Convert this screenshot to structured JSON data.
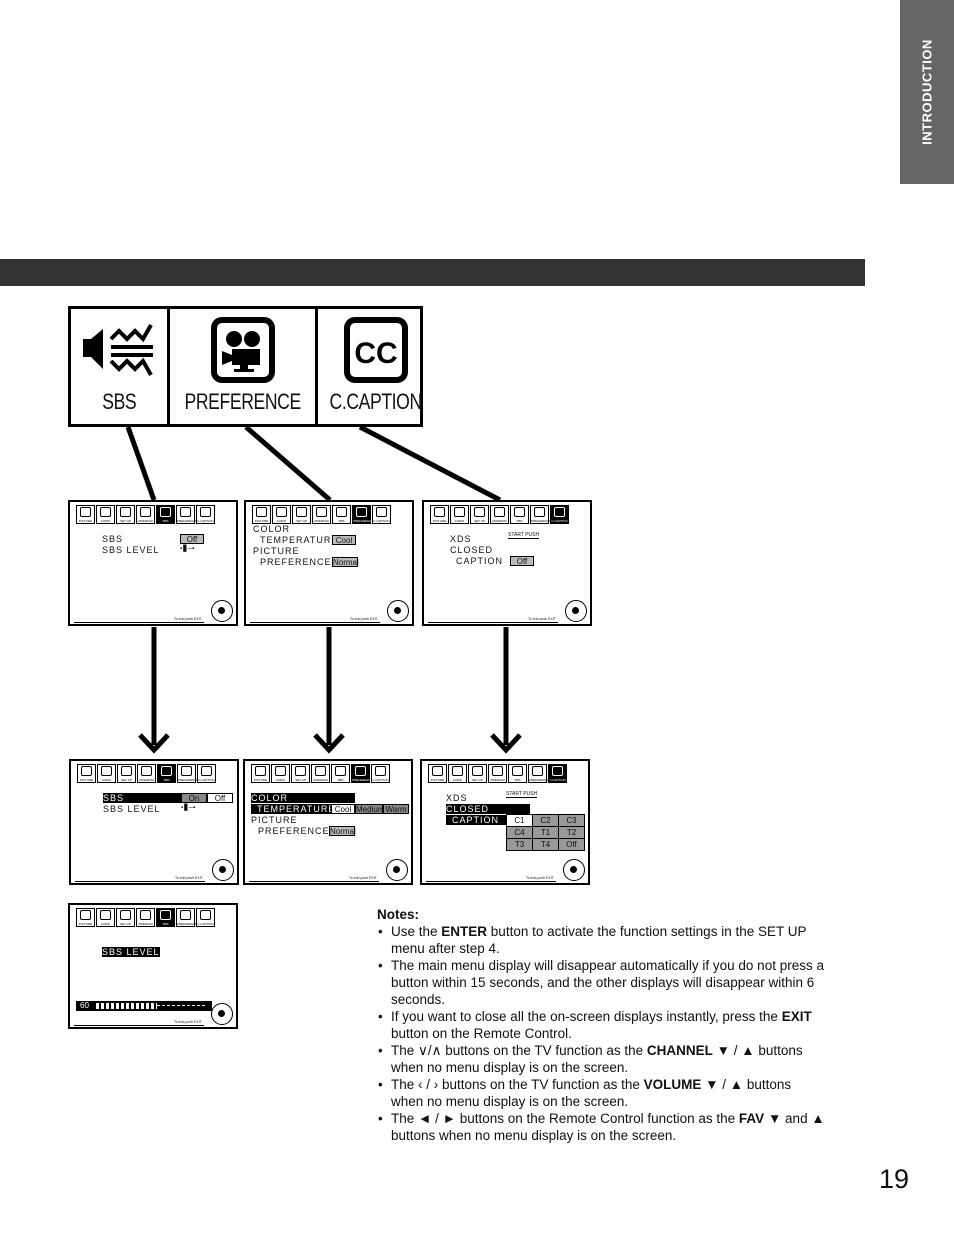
{
  "side_tab": {
    "label": "INTRODUCTION"
  },
  "icon_strip": [
    {
      "label": "SBS",
      "icon": "sbs-speaker-icon"
    },
    {
      "label": "PREFERENCE",
      "icon": "movie-camera-icon"
    },
    {
      "label": "C.CAPTION",
      "icon": "closed-caption-icon"
    }
  ],
  "menu_tabs": [
    "PICTURE",
    "AUDIO",
    "SET UP",
    "PREMIUM",
    "SBS",
    "PREFERENCE",
    "C.CAPTION"
  ],
  "exit_hint": "To end push EXIT",
  "screens": {
    "sbs_1": {
      "row1": "SBS",
      "row1_value": "Off",
      "row2": "SBS  LEVEL",
      "level_glyph": "▪▐▌‒‒▪"
    },
    "pref_1": {
      "row1": "COLOR",
      "row2": "TEMPERATURE",
      "row2_value": "Cool",
      "row3": "PICTURE",
      "row4": "PREFERENCE",
      "row4_value": "Normal"
    },
    "cc_1": {
      "row1": "XDS",
      "row1_value": "START PUSH",
      "row2": "CLOSED",
      "row3": "CAPTION",
      "row3_value": "Off"
    },
    "sbs_2": {
      "row1": "SBS",
      "options": [
        "On",
        "Off"
      ],
      "row2": "SBS  LEVEL",
      "level_glyph": "▪▐▌‒‒▪"
    },
    "pref_2": {
      "row1": "COLOR",
      "row2": "TEMPERATURE",
      "options": [
        "Cool",
        "Medium",
        "Warm"
      ],
      "row3": "PICTURE",
      "row4": "PREFERENCE",
      "row4_value": "Normal"
    },
    "cc_2": {
      "row1": "XDS",
      "row1_value": "START PUSH",
      "row2": "CLOSED",
      "row3": "CAPTION",
      "options": [
        "C1",
        "C2",
        "C3",
        "C4",
        "T1",
        "T2",
        "T3",
        "T4",
        "Off"
      ]
    },
    "sbs_level": {
      "title": "SBS  LEVEL",
      "value": "60",
      "level_fraction": 0.55
    }
  },
  "notes": {
    "title": "Notes:",
    "items": [
      {
        "pre": "Use the ",
        "bold": "ENTER",
        "post": " button to activate the function settings in the SET UP menu after step 4."
      },
      {
        "pre": "The main menu display will disappear automatically if you do not press a button within 15 seconds, and the other displays will disappear within 6 seconds.",
        "bold": "",
        "post": ""
      },
      {
        "pre": "If you want to close all the on-screen displays instantly, press the ",
        "bold": "EXIT",
        "post": " button on the Remote Control."
      },
      {
        "pre": "The  ∨/∧  buttons on the TV function as the ",
        "bold": "CHANNEL",
        "post": " ▼ / ▲ buttons when no menu display is on the screen."
      },
      {
        "pre": "The ‹ / › buttons on the TV function as the ",
        "bold": "VOLUME",
        "post": " ▼ / ▲ buttons when no menu display is on the screen."
      },
      {
        "pre": "The ◄ / ► buttons on the Remote Control function as the ",
        "bold": "FAV",
        "post": " ▼ and ▲ buttons when no menu display is on the screen."
      }
    ]
  },
  "page_number": "19"
}
